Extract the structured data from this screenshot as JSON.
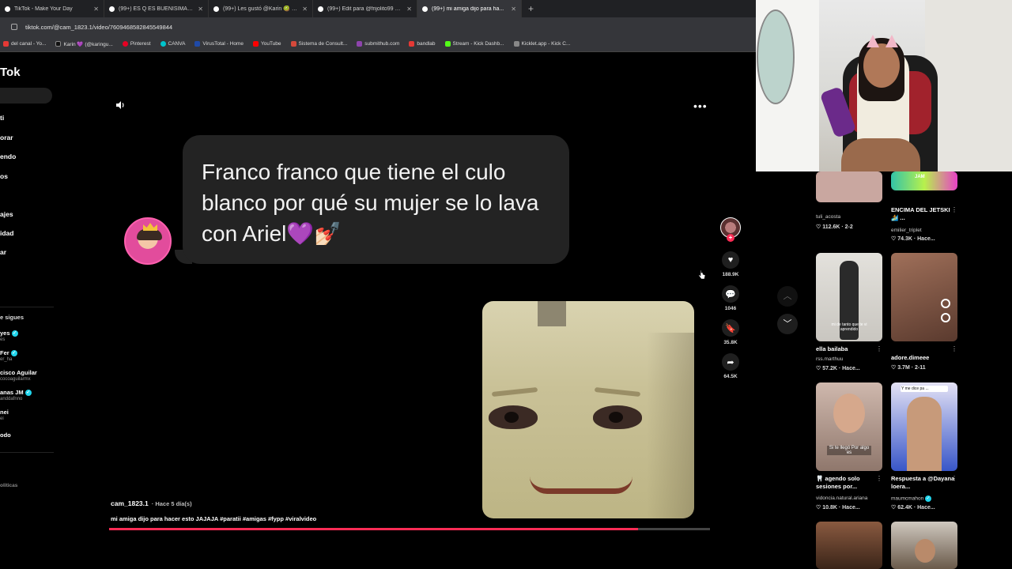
{
  "browser": {
    "tabs": [
      {
        "title": "TikTok - Make Your Day",
        "active": false
      },
      {
        "title": "(99+) ES Q ES BUENISIMAAAA",
        "active": false
      },
      {
        "title": "(99+) Les gustó @Karin 🥝 de...",
        "active": false
      },
      {
        "title": "(99+) Edit para @frijolito99 y @...",
        "active": false
      },
      {
        "title": "(99+) mi amiga dijo para ha...",
        "active": true
      }
    ],
    "new_tab": "+",
    "url": "tiktok.com/@cam_1823.1/video/7609468582845549844",
    "bookmarks": [
      {
        "label": "del canal - Yo...",
        "color": "#e53935"
      },
      {
        "label": "Karin 💜 (@karingu...",
        "color": "#111111"
      },
      {
        "label": "Pinterest",
        "color": "#e60023"
      },
      {
        "label": "CANVA",
        "color": "#00c4cc"
      },
      {
        "label": "VirusTotal - Home",
        "color": "#1f4aa8"
      },
      {
        "label": "YouTube",
        "color": "#ff0000"
      },
      {
        "label": "Sistema de Consult...",
        "color": "#d4493b"
      },
      {
        "label": "submithub.com",
        "color": "#8e44ad"
      },
      {
        "label": "bandlab",
        "color": "#e53935"
      },
      {
        "label": "Stream - Kick Dashb...",
        "color": "#53fc18"
      },
      {
        "label": "Kicklet.app - Kick C...",
        "color": "#888888"
      }
    ]
  },
  "sidebar": {
    "logo": "Tok",
    "nav": [
      "ti",
      "orar",
      "endo",
      "os",
      "ajes",
      "idad",
      "ar"
    ],
    "following_header": "e sigues",
    "following": [
      {
        "name": "yes",
        "sub": "es",
        "verified": true
      },
      {
        "name": "Fer",
        "sub": "er_ha",
        "verified": true
      },
      {
        "name": "cisco Aguilar",
        "sub": "cocoaguilarmx",
        "verified": false
      },
      {
        "name": "anas JM",
        "sub": "anddafnno",
        "verified": true
      },
      {
        "name": "nei",
        "sub": "ei",
        "verified": false
      },
      {
        "name": "odo",
        "sub": "",
        "verified": false
      }
    ],
    "footer": "oliticas"
  },
  "video": {
    "comment_bubble": "Franco franco que tiene el culo blanco por qué su mujer se lo lava con Ariel💜💅🏻",
    "author": "cam_1823.1",
    "posted": "· Hace 5 día(s)",
    "caption": "mi amiga dijo para hacer esto  JAJAJA #paratii #amigas #fypp #viralvideo",
    "progress": 0.88,
    "actions": {
      "likes": "188.9K",
      "comments": "1046",
      "saves": "35.8K",
      "shares": "64.5K"
    }
  },
  "recommended": [
    {
      "title": "",
      "author": "tuli_acosta",
      "stats": "♡ 112.6K · 2-2",
      "thumb": "#c9a7a0"
    },
    {
      "title": "ENCIMA DEL JETSKI 🏄 ...",
      "author": "emilier_triplet",
      "stats": "♡ 74.3K · Hace...",
      "thumb": "#33c3a8"
    },
    {
      "title": "ella bailaba",
      "author": "rss.marthuu",
      "stats": "♡ 57.2K · Hace...",
      "thumb": "#d7d4cf"
    },
    {
      "title": "adore.dimeee",
      "author": "",
      "stats": "♡ 3.7M · 2-11",
      "thumb": "#7a5a4a"
    },
    {
      "title": "🦷 agendo solo sesiones por...",
      "author": "vidoncia.natural.ariana",
      "stats": "♡ 10.8K · Hace...",
      "thumb": "#b69e93"
    },
    {
      "title": "Respuesta a @Dayana loera...",
      "author": "maumcmahon",
      "stats": "♡ 62.4K · Hace...",
      "thumb": "#7c8fd9"
    },
    {
      "title": "",
      "author": "",
      "stats": "",
      "thumb": "#6b4030"
    },
    {
      "title": "",
      "author": "",
      "stats": "",
      "thumb": "#8a7a6a"
    }
  ],
  "thumb_text": {
    "bailaba_overlay": "mi de tanto que te vi aprendido",
    "session_overlay": "Si te llegó Por algo es",
    "respuesta_overlay": "Y me dice pa ...",
    "jetski_tag": "JAM"
  },
  "icons": {
    "mute": "speaker-icon",
    "more": "more-icon",
    "like": "heart-icon",
    "comment": "comment-icon",
    "save": "bookmark-icon",
    "share": "share-icon"
  },
  "colors": {
    "accent": "#fe2c55",
    "bubble": "#232323",
    "verified": "#20d5ec"
  }
}
